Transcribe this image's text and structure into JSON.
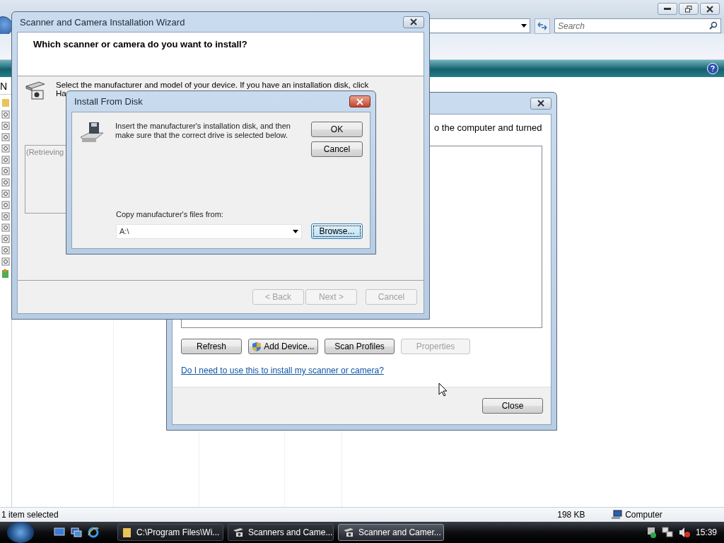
{
  "explorer": {
    "search": {
      "placeholder": "Search"
    },
    "column_header": "N",
    "status_bar": {
      "selection": "1 item selected",
      "size": "198 KB",
      "location": "Computer"
    }
  },
  "scanners_window": {
    "intro_fragment": "o the computer and turned",
    "buttons": [
      {
        "label": "Refresh",
        "disabled": false,
        "kind": "plain"
      },
      {
        "label": "Add Device...",
        "disabled": false,
        "kind": "shield"
      },
      {
        "label": "Scan Profiles",
        "disabled": false,
        "kind": "plain"
      },
      {
        "label": "Properties",
        "disabled": true,
        "kind": "plain"
      }
    ],
    "link": "Do I need to use this to install my scanner or camera?",
    "close_button": "Close"
  },
  "wizard": {
    "title": "Scanner and Camera Installation Wizard",
    "heading": "Which scanner or camera do you want to install?",
    "instruction": [
      "Select the manufacturer and model of your device. If you have an installation disk, click",
      "Ha"
    ],
    "list_placeholder": "(Retrieving",
    "buttons": [
      {
        "label": "< Back",
        "disabled": true
      },
      {
        "label": "Next >",
        "disabled": true
      },
      {
        "label": "Cancel",
        "disabled": true
      }
    ]
  },
  "install_dialog": {
    "title": "Install From Disk",
    "message": "Insert the manufacturer's installation disk, and then make sure that the correct drive is selected below.",
    "buttons": [
      {
        "label": "OK",
        "focused": false
      },
      {
        "label": "Cancel",
        "focused": false
      }
    ],
    "source_label": "Copy manufacturer's files from:",
    "source_value": "A:\\",
    "browse": {
      "label": "Browse...",
      "focused": true
    }
  },
  "taskbar": {
    "tasks": [
      {
        "label": "C:\\Program Files\\Wi...",
        "selected": false,
        "kind": "folder"
      },
      {
        "label": "Scanners and Came...",
        "selected": false,
        "kind": "scanner"
      },
      {
        "label": "Scanner and Camer...",
        "selected": true,
        "kind": "scanner"
      }
    ],
    "clock": "15:39"
  }
}
